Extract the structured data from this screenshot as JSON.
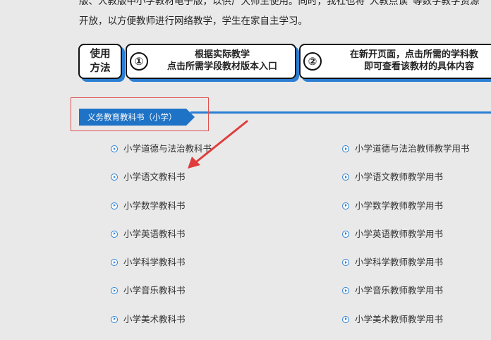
{
  "intro": {
    "line1": "版、人教版中小学教材电子版，以供广大师生使用。同时，我社也将“人教点读”等数字教学资源",
    "line2": "开放，以方便教师进行网络教学，学生在家自主学习。"
  },
  "usage": {
    "label": "使用方法",
    "step1_num": "①",
    "step1_line1": "根据实际教学",
    "step1_line2": "点击所需学段教材版本入口",
    "step2_num": "②",
    "step2_line1": "在新开页面，点击所需的学科教",
    "step2_line2": "即可查看该教材的具体内容"
  },
  "section": {
    "title": "义务教育教科书（小学）"
  },
  "books_left": [
    {
      "label": "小学道德与法治教科书"
    },
    {
      "label": "小学语文教科书"
    },
    {
      "label": "小学数学教科书"
    },
    {
      "label": "小学英语教科书"
    },
    {
      "label": "小学科学教科书"
    },
    {
      "label": "小学音乐教科书"
    },
    {
      "label": "小学美术教科书"
    }
  ],
  "books_right": [
    {
      "label": "小学道德与法治教师教学用书"
    },
    {
      "label": "小学语文教师教学用书"
    },
    {
      "label": "小学数学教师教学用书"
    },
    {
      "label": "小学英语教师教学用书"
    },
    {
      "label": "小学科学教师教学用书"
    },
    {
      "label": "小学音乐教师教学用书"
    },
    {
      "label": "小学美术教师教学用书"
    }
  ],
  "colors": {
    "accent": "#1f73c7",
    "annotation": "#e03c3c",
    "background": "#e9e9e9"
  }
}
